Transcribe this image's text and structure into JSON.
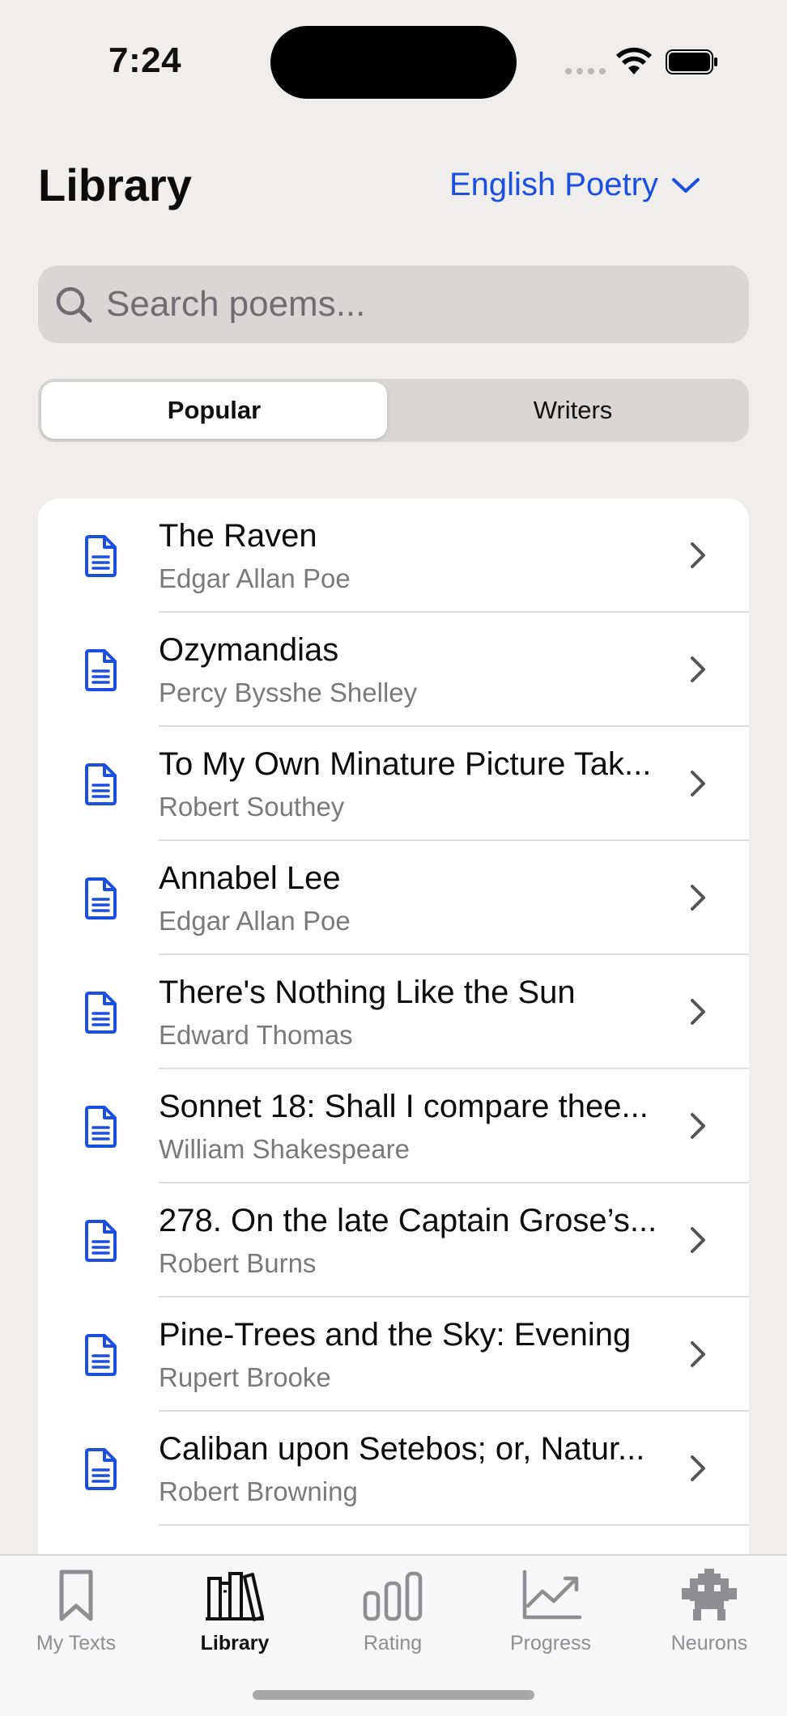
{
  "status_bar": {
    "time": "7:24"
  },
  "header": {
    "title": "Library",
    "language": "English Poetry"
  },
  "search": {
    "placeholder": "Search poems..."
  },
  "segments": {
    "popular": "Popular",
    "writers": "Writers",
    "selected": "Popular"
  },
  "poems": [
    {
      "title": "The Raven",
      "author": "Edgar Allan Poe"
    },
    {
      "title": "Ozymandias",
      "author": "Percy Bysshe Shelley"
    },
    {
      "title": "To My Own Minature Picture Tak...",
      "author": "Robert Southey"
    },
    {
      "title": "Annabel Lee",
      "author": "Edgar Allan Poe"
    },
    {
      "title": "There's Nothing Like the Sun",
      "author": "Edward Thomas"
    },
    {
      "title": "Sonnet 18: Shall I compare thee...",
      "author": "William Shakespeare"
    },
    {
      "title": "278. On the late Captain Grose’s...",
      "author": "Robert Burns"
    },
    {
      "title": "Pine-Trees and the Sky: Evening",
      "author": "Rupert Brooke"
    },
    {
      "title": "Caliban upon Setebos; or, Natur...",
      "author": "Robert Browning"
    }
  ],
  "tabs": [
    {
      "label": "My Texts",
      "icon": "bookmark-icon"
    },
    {
      "label": "Library",
      "icon": "books-icon"
    },
    {
      "label": "Rating",
      "icon": "bar-chart-icon"
    },
    {
      "label": "Progress",
      "icon": "trend-chart-icon"
    },
    {
      "label": "Neurons",
      "icon": "robot-icon"
    }
  ],
  "selected_tab": "Library",
  "colors": {
    "accent": "#1a4fe0",
    "background": "#efeeec",
    "secondary_text": "#7a7a7e"
  }
}
